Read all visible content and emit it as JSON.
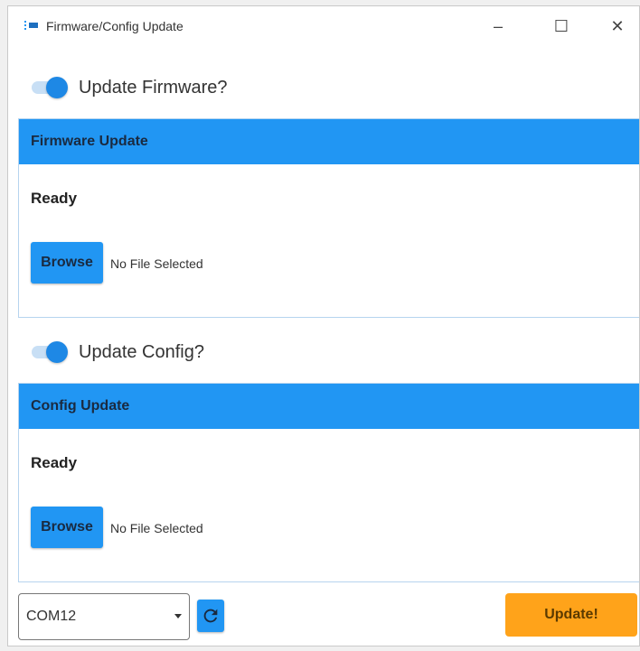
{
  "window": {
    "title": "Firmware/Config Update",
    "controls": {
      "minimize": "–",
      "maximize": "☐",
      "close": "✕"
    }
  },
  "firmware": {
    "toggle_label": "Update Firmware?",
    "toggle_on": true,
    "panel_title": "Firmware Update",
    "status": "Ready",
    "browse_label": "Browse",
    "file_label": "No File Selected"
  },
  "config": {
    "toggle_label": "Update Config?",
    "toggle_on": true,
    "panel_title": "Config Update",
    "status": "Ready",
    "browse_label": "Browse",
    "file_label": "No File Selected"
  },
  "footer": {
    "port_selected": "COM12",
    "refresh_icon": "refresh-icon",
    "update_label": "Update!"
  },
  "colors": {
    "accent": "#2196f3",
    "toggle_knob": "#1e88e5",
    "update_button": "#ffa31a",
    "panel_border": "#b6d4ef"
  }
}
